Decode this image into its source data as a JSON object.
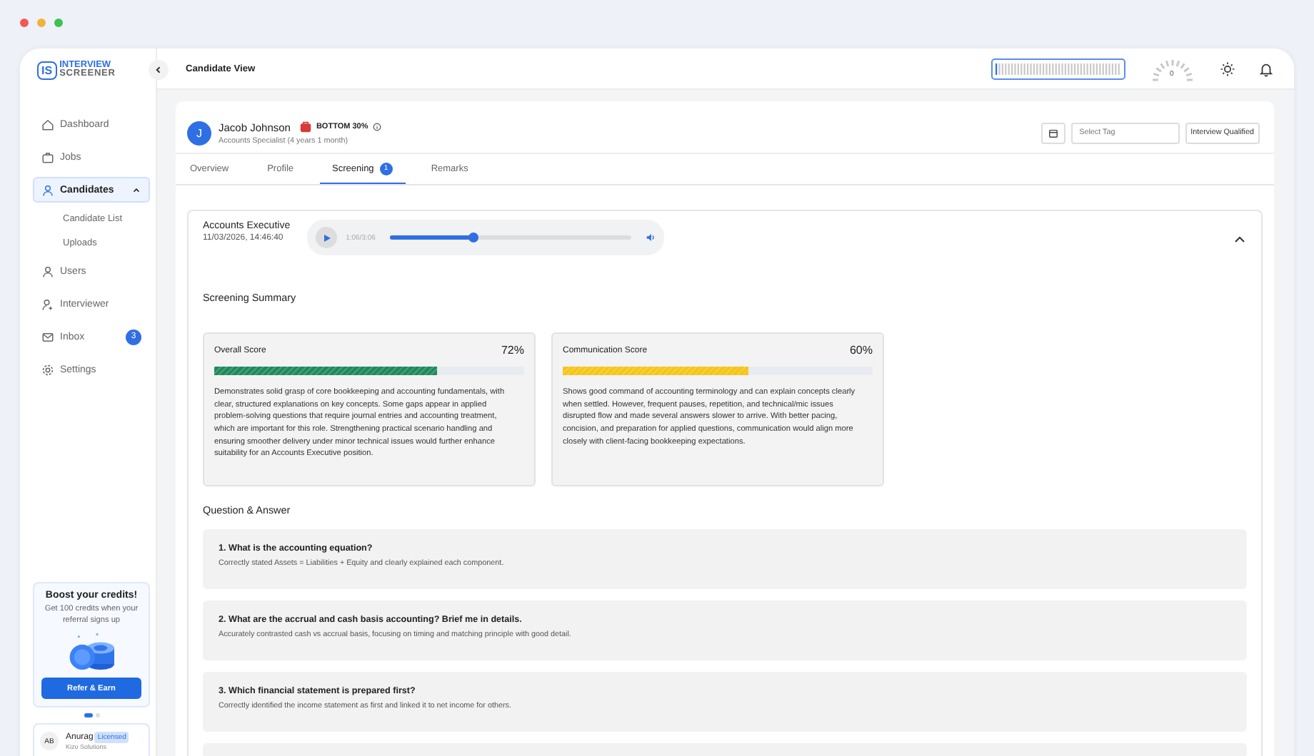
{
  "sidebar": {
    "logo": {
      "mark": "IS",
      "line_1": "INTERVIEW",
      "line_2": "SCREENER"
    },
    "items": [
      {
        "label": "Dashboard",
        "selected": false
      },
      {
        "label": "Jobs",
        "selected": false
      },
      {
        "label": "Candidates",
        "selected": true,
        "expanded": true,
        "children": [
          {
            "label": "Candidate List"
          },
          {
            "label": "Uploads"
          }
        ]
      },
      {
        "label": "Users",
        "selected": false
      },
      {
        "label": "Interviewer",
        "selected": false
      },
      {
        "label": "Inbox",
        "selected": false,
        "badge": "3"
      },
      {
        "label": "Settings",
        "selected": false
      }
    ],
    "promo": {
      "title": "Boost your credits!",
      "text": "Get 100 credits when your referral signs up",
      "button": "Refer & Earn"
    },
    "carousel": [
      {
        "selected": true
      },
      {
        "selected": false
      }
    ],
    "user": {
      "initials": "AB",
      "name": "Anurag",
      "badge": "Licensed",
      "organization": "Kizo Solutions"
    }
  },
  "header": {
    "title": "Candidate View",
    "gauge_reading": "0"
  },
  "candidate": {
    "avatar": "J",
    "name": "Jacob Johnson",
    "rank": "BOTTOM 30%",
    "subtitle": "Accounts Specialist (4 years 1 month)",
    "tag": {
      "placeholder": "Select Tag"
    },
    "status_button": "Interview Qualified"
  },
  "tabs": [
    {
      "label": "Overview",
      "selected": false
    },
    {
      "label": "Profile",
      "selected": false
    },
    {
      "label": "Screening",
      "selected": true,
      "badge": "1"
    },
    {
      "label": "Remarks",
      "selected": false
    }
  ],
  "screening": {
    "role": "Accounts Executive",
    "datetime": "11/03/2026, 14:46:40",
    "expanded": true,
    "audio": {
      "time": "1:06/3:06",
      "level": 0.35
    },
    "summary_title": "Screening Summary",
    "scores": [
      {
        "label": "Overall Score",
        "value": "72%",
        "level": 0.72,
        "color": "#1f8a5b",
        "text": "Demonstrates solid grasp of core bookkeeping and accounting fundamentals, with clear, structured explanations on key concepts. Some gaps appear in applied problem-solving questions that require journal entries and accounting treatment, which are important for this role. Strengthening practical scenario handling and ensuring smoother delivery under minor technical issues would further enhance suitability for an Accounts Executive position."
      },
      {
        "label": "Communication Score",
        "value": "60%",
        "level": 0.6,
        "color": "#f5c518",
        "text": "Shows good command of accounting terminology and can explain concepts clearly when settled. However, frequent pauses, repetition, and technical/mic issues disrupted flow and made several answers slower to arrive. With better pacing, concision, and preparation for applied questions, communication would align more closely with client-facing bookkeeping expectations."
      }
    ],
    "qa_title": "Question & Answer",
    "qa": [
      {
        "question": "1. What is the accounting equation?",
        "answer": "Correctly stated Assets = Liabilities + Equity and clearly explained each component."
      },
      {
        "question": "2. What are the accrual and cash basis accounting? Brief me in details.",
        "answer": "Accurately contrasted cash vs accrual basis, focusing on timing and matching principle with good detail."
      },
      {
        "question": "3. Which financial statement is prepared first?",
        "answer": "Correctly identified the income statement as first and linked it to net income for others."
      }
    ]
  }
}
